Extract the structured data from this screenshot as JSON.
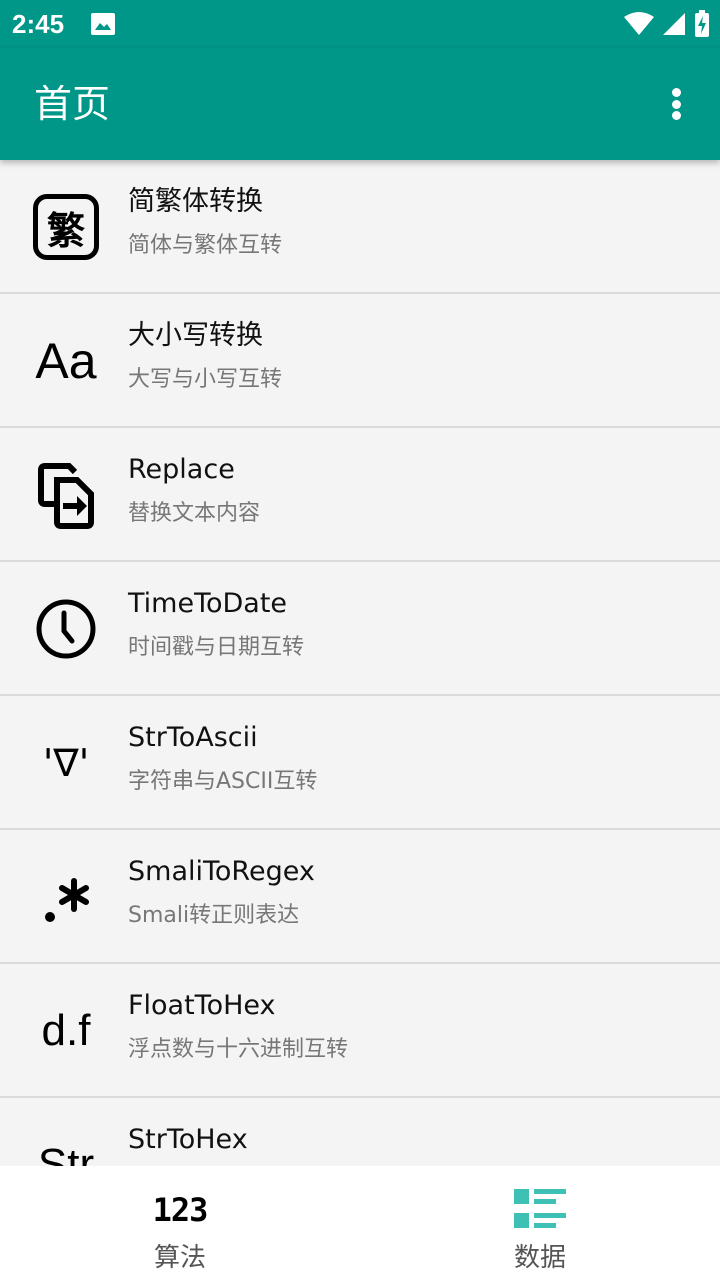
{
  "status_bar": {
    "time": "2:45"
  },
  "app_bar": {
    "title": "首页"
  },
  "list": {
    "items": [
      {
        "icon": "fan-character-icon",
        "icon_text": "繁",
        "title": "简繁体转换",
        "subtitle": "简体与繁体互转"
      },
      {
        "icon": "letter-case-icon",
        "icon_text": "Aa",
        "title": "大小写转换",
        "subtitle": "大写与小写互转"
      },
      {
        "icon": "replace-icon",
        "icon_text": "",
        "title": "Replace",
        "subtitle": "替换文本内容"
      },
      {
        "icon": "clock-icon",
        "icon_text": "",
        "title": "TimeToDate",
        "subtitle": "时间戳与日期互转"
      },
      {
        "icon": "ascii-face-icon",
        "icon_text": "'∇'",
        "title": "StrToAscii",
        "subtitle": "字符串与ASCII互转"
      },
      {
        "icon": "regex-icon",
        "icon_text": ".*",
        "title": "SmaliToRegex",
        "subtitle": "Smali转正则表达"
      },
      {
        "icon": "float-icon",
        "icon_text": "d.f",
        "title": "FloatToHex",
        "subtitle": "浮点数与十六进制互转"
      },
      {
        "icon": "string-icon",
        "icon_text": "Str",
        "title": "StrToHex",
        "subtitle": ""
      }
    ]
  },
  "bottom_nav": {
    "items": [
      {
        "icon": "numbers-icon",
        "icon_text": "123",
        "label": "算法",
        "active": false
      },
      {
        "icon": "list-icon",
        "icon_text": "",
        "label": "数据",
        "active": true
      }
    ]
  },
  "colors": {
    "primary": "#009688",
    "accent": "#3ec1b4",
    "background": "#f4f4f4",
    "divider": "#dadada"
  }
}
